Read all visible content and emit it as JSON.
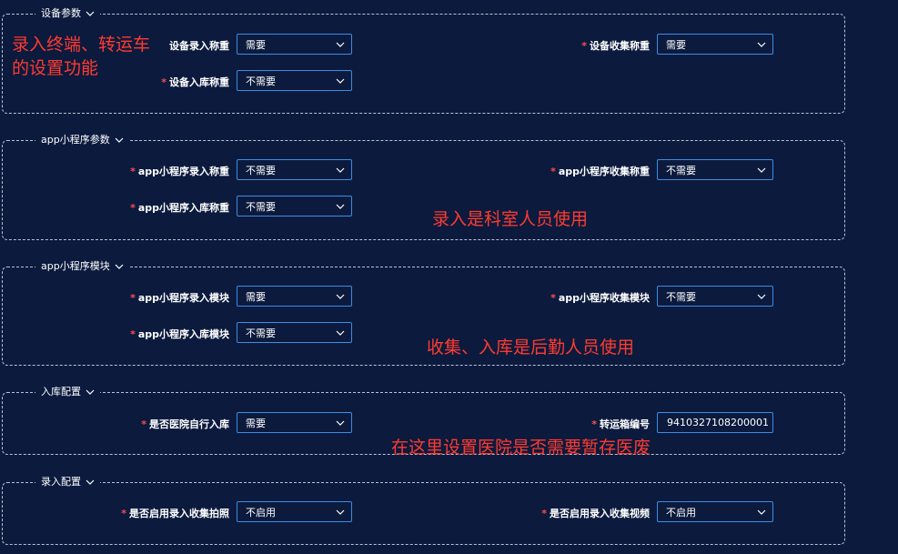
{
  "sections": {
    "device": {
      "title": "设备参数",
      "input_weigh_label": "设备录入称重",
      "input_weigh_value": "需要",
      "collect_weigh_label": "设备收集称重",
      "collect_weigh_value": "需要",
      "storage_weigh_label": "设备入库称重",
      "storage_weigh_value": "不需要"
    },
    "app_params": {
      "title": "app小程序参数",
      "input_weigh_label": "app小程序录入称重",
      "input_weigh_value": "不需要",
      "collect_weigh_label": "app小程序收集称重",
      "collect_weigh_value": "不需要",
      "storage_weigh_label": "app小程序入库称重",
      "storage_weigh_value": "不需要"
    },
    "app_modules": {
      "title": "app小程序模块",
      "input_module_label": "app小程序录入模块",
      "input_module_value": "需要",
      "collect_module_label": "app小程序收集模块",
      "collect_module_value": "不需要",
      "storage_module_label": "app小程序入库模块",
      "storage_module_value": "不需要"
    },
    "storage_config": {
      "title": "入库配置",
      "self_storage_label": "是否医院自行入库",
      "self_storage_value": "需要",
      "box_no_label": "转运箱编号",
      "box_no_value": "9410327108200001"
    },
    "input_config": {
      "title": "录入配置",
      "photo_label": "是否启用录入收集拍照",
      "photo_value": "不启用",
      "video_label": "是否启用录入收集视频",
      "video_value": "不启用"
    }
  },
  "required_mark": "*",
  "annotations": {
    "note1_line1": "录入终端、转运车",
    "note1_line2": "的设置功能",
    "note2": "录入是科室人员使用",
    "note3": "收集、入库是后勤人员使用",
    "note4": "在这里设置医院是否需要暂存医废"
  },
  "colors": {
    "background": "#0b1a3d",
    "field_border": "#3a8ee6",
    "required": "#ff4d4f",
    "annotation": "#ff3b30"
  }
}
